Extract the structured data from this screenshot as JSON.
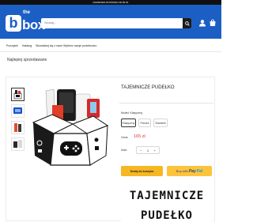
{
  "topbar": {
    "text": "DARMOWA DOSTAWA OD 99 ZŁ"
  },
  "logo": {
    "the": "the",
    "letter": "b",
    "box": "box"
  },
  "header": {
    "search_placeholder": "Szukaj..."
  },
  "nav": {
    "items": [
      {
        "label": "Początek"
      },
      {
        "label": "Katalog"
      },
      {
        "label": "Skontaktuj się z nami"
      },
      {
        "label": "Wybierz swoje pudełeczko"
      }
    ]
  },
  "breadcrumb": "Najlepiej sprzedawane",
  "product": {
    "title": "TAJEMNICZE PUDEŁKO",
    "model_label": "Model: Klasyczny",
    "variants": [
      {
        "label": "Klasyczny",
        "selected": true
      },
      {
        "label": "Prezes",
        "selected": false
      },
      {
        "label": "Diament",
        "selected": false
      }
    ],
    "price_label": "Cena:",
    "price": "165 zł",
    "qty_label": "Ilość:",
    "qty_minus": "−",
    "qty_value": "1",
    "qty_plus": "+",
    "add_to_cart": "Dodaj do koszyka",
    "paypal_buy": "Buy with",
    "paypal_pay": "Pay",
    "paypal_pal": "Pal"
  },
  "promo": {
    "line1": "TAJEMNICZE",
    "line2": "PUDEŁKO"
  },
  "colors": {
    "brand_blue": "#1c5fc4",
    "accent_yellow": "#f5b722",
    "price_red": "#d5363a"
  }
}
